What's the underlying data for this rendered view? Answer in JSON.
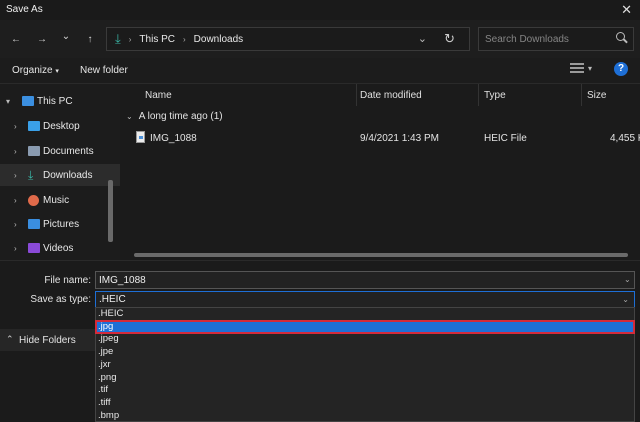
{
  "window": {
    "title": "Save As",
    "close_glyph": "✕"
  },
  "nav": {
    "back_glyph": "←",
    "forward_glyph": "→",
    "recent_glyph": "⌄",
    "up_glyph": "↑",
    "address": [
      "This PC",
      "Downloads"
    ],
    "address_icon": "download-arrow-icon",
    "search_placeholder": "Search Downloads"
  },
  "toolbar": {
    "organize_label": "Organize",
    "new_folder_label": "New folder",
    "help_glyph": "?"
  },
  "sidebar": {
    "items": [
      {
        "label": "This PC",
        "icon": "pc-icon",
        "color": "#3b8fe0"
      },
      {
        "label": "Desktop",
        "icon": "desktop-icon",
        "color": "#3aa0e8"
      },
      {
        "label": "Documents",
        "icon": "documents-icon",
        "color": "#8a9bb0"
      },
      {
        "label": "Downloads",
        "icon": "download-arrow-icon",
        "color": "#39b3a3"
      },
      {
        "label": "Music",
        "icon": "music-icon",
        "color": "#e06a4a"
      },
      {
        "label": "Pictures",
        "icon": "pictures-icon",
        "color": "#3a8ee0"
      },
      {
        "label": "Videos",
        "icon": "videos-icon",
        "color": "#8a4ad8"
      }
    ]
  },
  "columns": [
    "Name",
    "Date modified",
    "Type",
    "Size"
  ],
  "group": {
    "label": "A long time ago (1)"
  },
  "files": [
    {
      "name": "IMG_1088",
      "date": "9/4/2021 1:43 PM",
      "type": "HEIC File",
      "size": "4,455 K"
    }
  ],
  "save": {
    "file_name_label": "File name:",
    "file_name_value": "IMG_1088",
    "type_label": "Save as type:",
    "type_value": ".HEIC",
    "hide_folders_label": "Hide Folders"
  },
  "type_options": [
    ".HEIC",
    ".jpg",
    ".jpeg",
    ".jpe",
    ".jxr",
    ".png",
    ".tif",
    ".tiff",
    ".bmp"
  ],
  "selected_option": ".jpg",
  "colors": {
    "accent": "#1e6fd6",
    "highlight_border": "#d42a3a"
  }
}
